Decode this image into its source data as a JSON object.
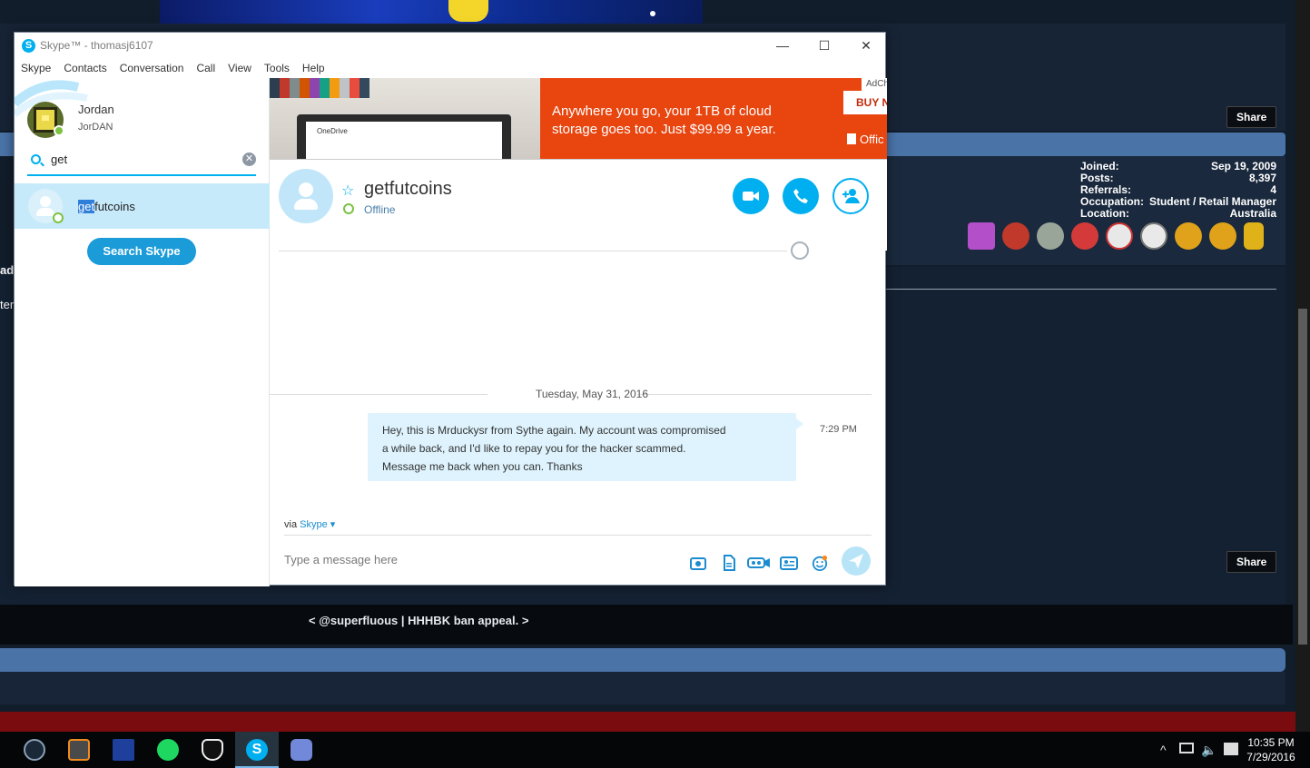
{
  "background_page": {
    "share_label": "Share",
    "stats": [
      {
        "label": "Joined:",
        "value": "Sep 19, 2009"
      },
      {
        "label": "Posts:",
        "value": "8,397"
      },
      {
        "label": "Referrals:",
        "value": "4"
      },
      {
        "label": "Occupation:",
        "value": "Student / Retail Manager"
      },
      {
        "label": "Location:",
        "value": "Australia"
      }
    ],
    "footer_link": "< @superfluous | HHHBK ban appeal. >",
    "left_cut_1": "ad",
    "left_cut_2": "ter"
  },
  "window": {
    "title": "Skype™ - thomasj6107",
    "minimize": "—",
    "maximize": "☐",
    "close": "✕"
  },
  "menu": [
    "Skype",
    "Contacts",
    "Conversation",
    "Call",
    "View",
    "Tools",
    "Help"
  ],
  "profile": {
    "name": "Jordan",
    "mood": "JorDAN",
    "status_color": "#7cc242"
  },
  "search": {
    "value": "get",
    "clear_icon": "clear-icon"
  },
  "search_results": [
    {
      "highlight": "get",
      "rest": "futcoins"
    }
  ],
  "search_skype_label": "Search Skype",
  "ad": {
    "tag": "AdCh",
    "buy_label": "BUY N",
    "copy_line1": "Anywhere you go, your 1TB of cloud",
    "copy_line2": "storage goes too. Just $99.99 a year.",
    "brand": "Offic",
    "screen_label": "OneDrive"
  },
  "conversation": {
    "contact_name": "getfutcoins",
    "status": "Offline",
    "date_separator": "Tuesday, May 31, 2016",
    "messages": [
      {
        "lines": [
          "Hey, this is Mrduckysr from Sythe again. My account was compromised",
          "a while back, and I'd like to repay you for the hacker scammed.",
          "Message me back when you can. Thanks"
        ],
        "time": "7:29 PM"
      }
    ],
    "via_prefix": "via",
    "via_service": "Skype",
    "compose_placeholder": "Type a message here"
  },
  "taskbar": {
    "clock_time": "10:35 PM",
    "clock_date": "7/29/2016",
    "icons": [
      "steam-icon",
      "sublime-icon",
      "network-app-icon",
      "spotify-icon",
      "fox-app-icon",
      "skype-icon",
      "discord-icon"
    ]
  }
}
